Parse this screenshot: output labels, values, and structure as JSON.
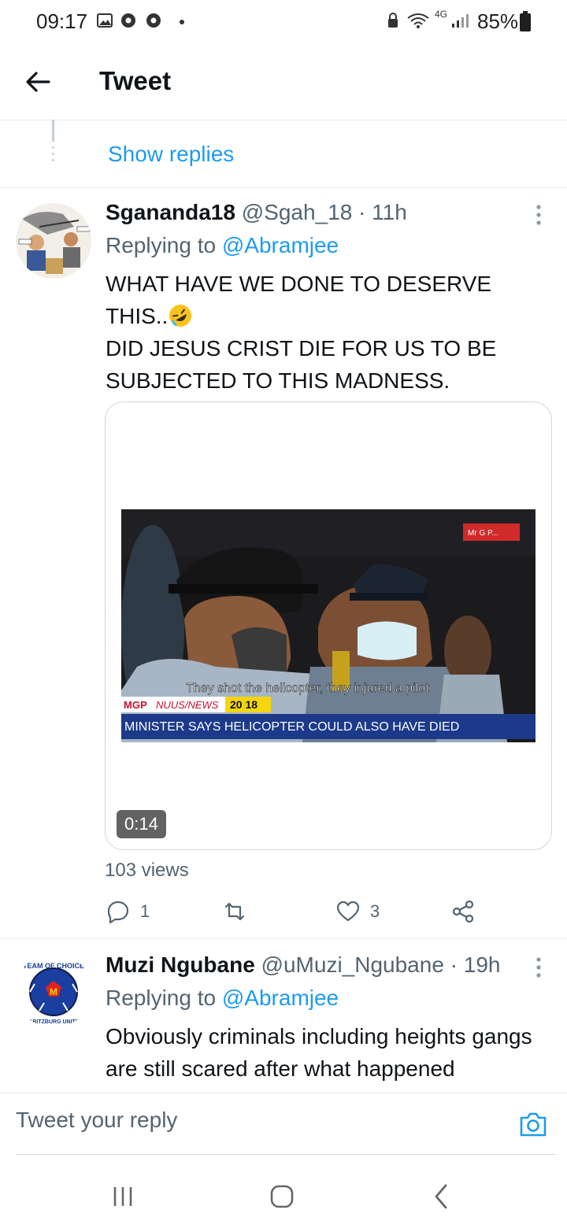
{
  "status_bar": {
    "time": "09:17",
    "battery": "85%",
    "network": "4G"
  },
  "header": {
    "title": "Tweet"
  },
  "thread": {
    "show_replies": "Show replies"
  },
  "tweet1": {
    "display_name": "Sgananda18",
    "meta": " @Sgah_18 · 11h",
    "replying_prefix": "Replying to ",
    "replying_to": "@Abramjee",
    "body_line1": "WHAT HAVE WE DONE TO DESERVE",
    "body_line2": "THIS..",
    "body_line3": "DID JESUS CRIST DIE FOR US TO BE",
    "body_line4": "SUBJECTED TO THIS MADNESS.",
    "video": {
      "channel_tag": "Mr G P...",
      "subtitle": "They shot the helicopter, they injured a pilot",
      "ticker_brand": "MGP",
      "ticker_label": "NUUS/NEWS",
      "ticker_time": "20 18",
      "headline": "MINISTER SAYS HELICOPTER COULD ALSO HAVE DIED",
      "duration": "0:14"
    },
    "views": "103 views",
    "replies": "1",
    "retweets": "",
    "likes": "3"
  },
  "tweet2": {
    "display_name": "Muzi Ngubane",
    "meta": " @uMuzi_Ngubane · 19h",
    "replying_prefix": "Replying to ",
    "replying_to": "@Abramjee",
    "body": "Obviously criminals including heights gangs are still scared after what happened Rosettenville was the last",
    "avatar_text_top": "TEAM OF CHOICE",
    "avatar_text_bottom": "MARITZBURG UNITED"
  },
  "composer": {
    "placeholder": "Tweet your reply"
  },
  "colors": {
    "accent": "#1d9bf0",
    "text": "#0f1419",
    "secondary": "#536471"
  }
}
